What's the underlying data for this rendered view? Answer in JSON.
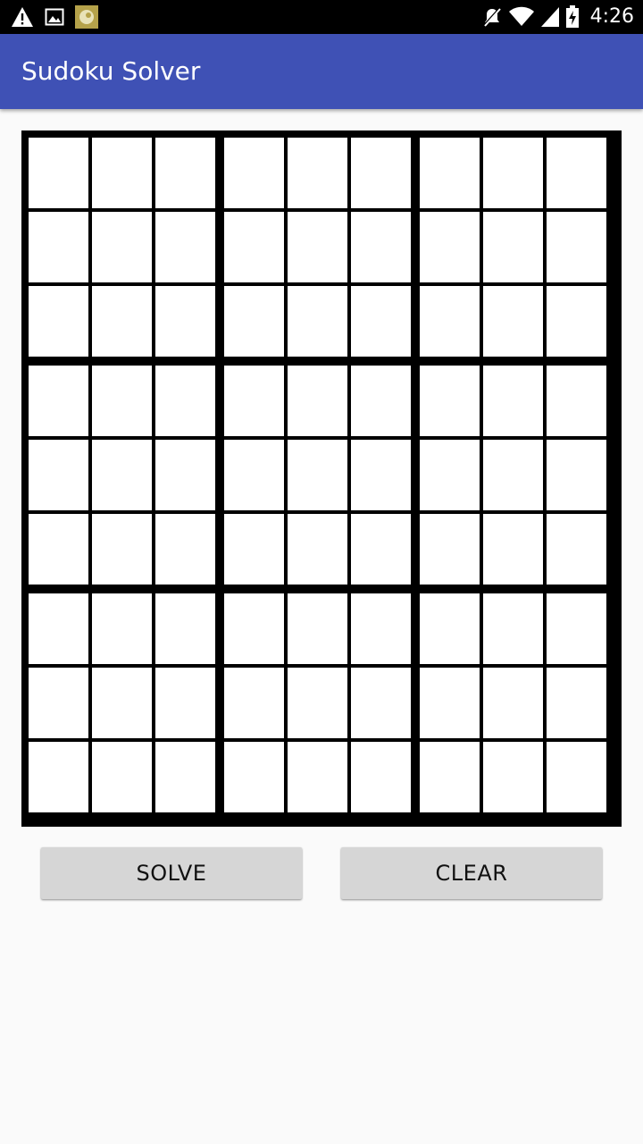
{
  "status_bar": {
    "time": "4:26",
    "icons_left": [
      "warning-icon",
      "image-icon",
      "app-notification-icon"
    ],
    "icons_right": [
      "mute-icon",
      "wifi-icon",
      "signal-icon",
      "battery-icon"
    ]
  },
  "app_bar": {
    "title": "Sudoku Solver",
    "color": "#3f51b5"
  },
  "grid": {
    "rows": 9,
    "cols": 9,
    "cells": [
      [
        "",
        "",
        "",
        "",
        "",
        "",
        "",
        "",
        ""
      ],
      [
        "",
        "",
        "",
        "",
        "",
        "",
        "",
        "",
        ""
      ],
      [
        "",
        "",
        "",
        "",
        "",
        "",
        "",
        "",
        ""
      ],
      [
        "",
        "",
        "",
        "",
        "",
        "",
        "",
        "",
        ""
      ],
      [
        "",
        "",
        "",
        "",
        "",
        "",
        "",
        "",
        ""
      ],
      [
        "",
        "",
        "",
        "",
        "",
        "",
        "",
        "",
        ""
      ],
      [
        "",
        "",
        "",
        "",
        "",
        "",
        "",
        "",
        ""
      ],
      [
        "",
        "",
        "",
        "",
        "",
        "",
        "",
        "",
        ""
      ],
      [
        "",
        "",
        "",
        "",
        "",
        "",
        "",
        "",
        ""
      ]
    ]
  },
  "buttons": {
    "solve_label": "SOLVE",
    "clear_label": "CLEAR"
  }
}
